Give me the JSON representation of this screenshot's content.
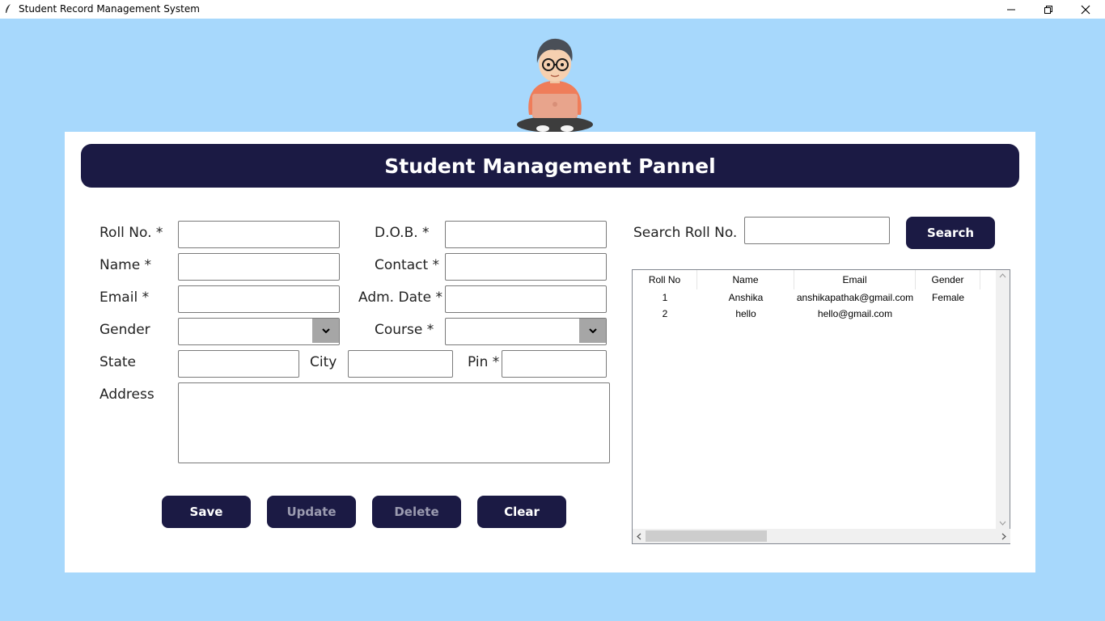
{
  "window": {
    "title": "Student Record Management System"
  },
  "header": {
    "title": "Student Management Pannel"
  },
  "form": {
    "roll_label": "Roll No. *",
    "name_label": "Name *",
    "email_label": "Email *",
    "gender_label": "Gender",
    "state_label": "State",
    "address_label": "Address",
    "dob_label": "D.O.B. *",
    "contact_label": "Contact *",
    "adm_label": "Adm. Date *",
    "course_label": "Course *",
    "city_label": "City",
    "pin_label": "Pin *"
  },
  "buttons": {
    "save": "Save",
    "update": "Update",
    "delete": "Delete",
    "clear": "Clear",
    "search": "Search"
  },
  "search": {
    "label": "Search Roll No."
  },
  "table": {
    "columns": [
      "Roll No",
      "Name",
      "Email",
      "Gender"
    ],
    "rows": [
      [
        "1",
        "Anshika",
        "anshikapathak@gmail.com",
        "Female"
      ],
      [
        "2",
        "hello",
        "hello@gmail.com",
        ""
      ]
    ]
  },
  "colors": {
    "background": "#a7d8fc",
    "accent": "#1b1a44",
    "panel": "#ffffff"
  },
  "icons": [
    "feather-icon",
    "minimize-icon",
    "restore-icon",
    "close-icon",
    "chevron-down-icon",
    "scroll-up-icon",
    "scroll-down-icon",
    "scroll-left-icon",
    "scroll-right-icon"
  ]
}
